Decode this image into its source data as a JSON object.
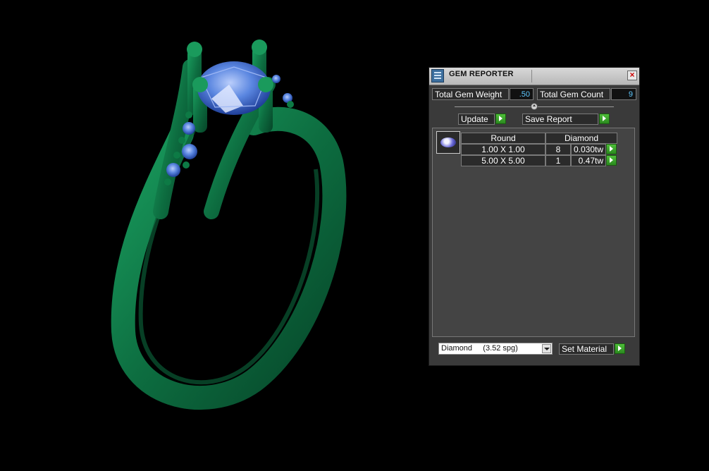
{
  "window": {
    "title": "GEM REPORTER",
    "close_label": "×"
  },
  "summary": {
    "total_weight_label": "Total Gem Weight",
    "total_weight_value": ".50",
    "total_count_label": "Total Gem Count",
    "total_count_value": "9"
  },
  "actions": {
    "update_label": "Update",
    "save_report_label": "Save Report"
  },
  "gem_table": {
    "shape": "Round",
    "material": "Diamond",
    "rows": [
      {
        "size": "1.00 X 1.00",
        "count": "8",
        "weight": "0.030tw"
      },
      {
        "size": "5.00 X 5.00",
        "count": "1",
        "weight": "0.47tw"
      }
    ]
  },
  "material": {
    "selected": "Diamond     (3.52 spg)",
    "set_label": "Set Material"
  },
  "colors": {
    "metal": "#0f7a4a",
    "stone": "#4b7bd6",
    "accent_value": "#5ec8ff",
    "go_button": "#3da52c"
  }
}
